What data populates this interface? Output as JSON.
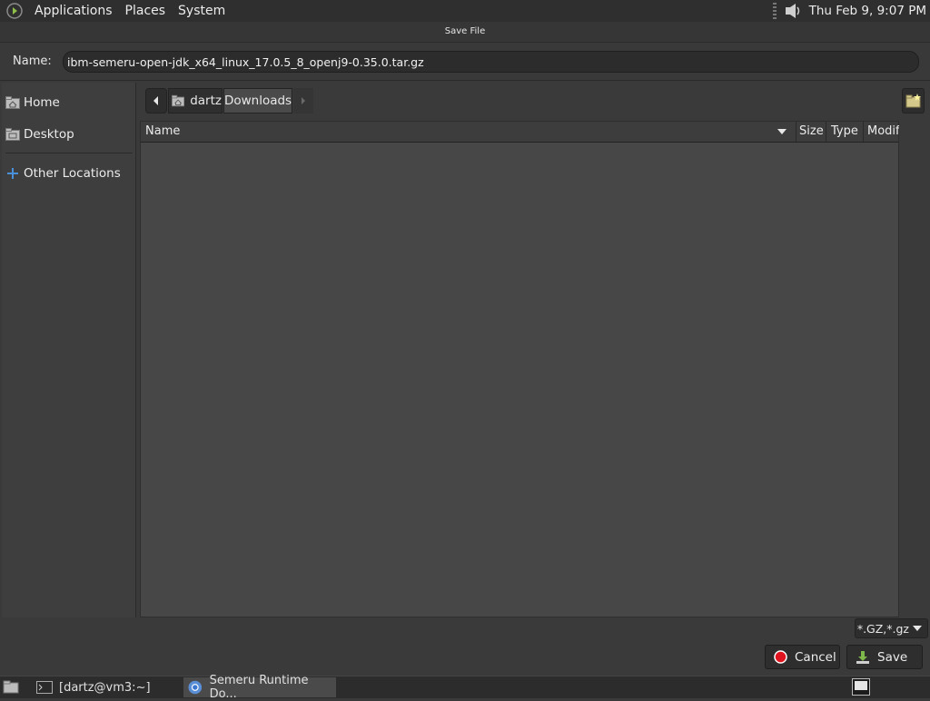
{
  "top_panel": {
    "menus": [
      "Applications",
      "Places",
      "System"
    ],
    "clock": "Thu Feb  9,  9:07 PM"
  },
  "dialog": {
    "title": "Save File",
    "name_label": "Name:",
    "name_value": "ibm-semeru-open-jdk_x64_linux_17.0.5_8_openj9-0.35.0.tar.gz"
  },
  "sidebar": {
    "items": [
      {
        "label": "Home",
        "icon": "home-folder-icon"
      },
      {
        "label": "Desktop",
        "icon": "desktop-folder-icon"
      },
      {
        "label": "Other Locations",
        "icon": "plus-icon"
      }
    ]
  },
  "pathbar": {
    "segments": [
      "dartz",
      "Downloads"
    ]
  },
  "file_list": {
    "columns": [
      "Name",
      "Size",
      "Type",
      "Modif"
    ]
  },
  "filter": {
    "selected": "*.GZ,*.gz"
  },
  "buttons": {
    "cancel": "Cancel",
    "save": "Save"
  },
  "taskbar": {
    "tasks": [
      "[dartz@vm3:~]",
      "Semeru Runtime Do..."
    ]
  },
  "colors": {
    "cancel_icon": "#e0141e",
    "save_icon": "#7fb84a",
    "accent": "#4a90d9"
  }
}
